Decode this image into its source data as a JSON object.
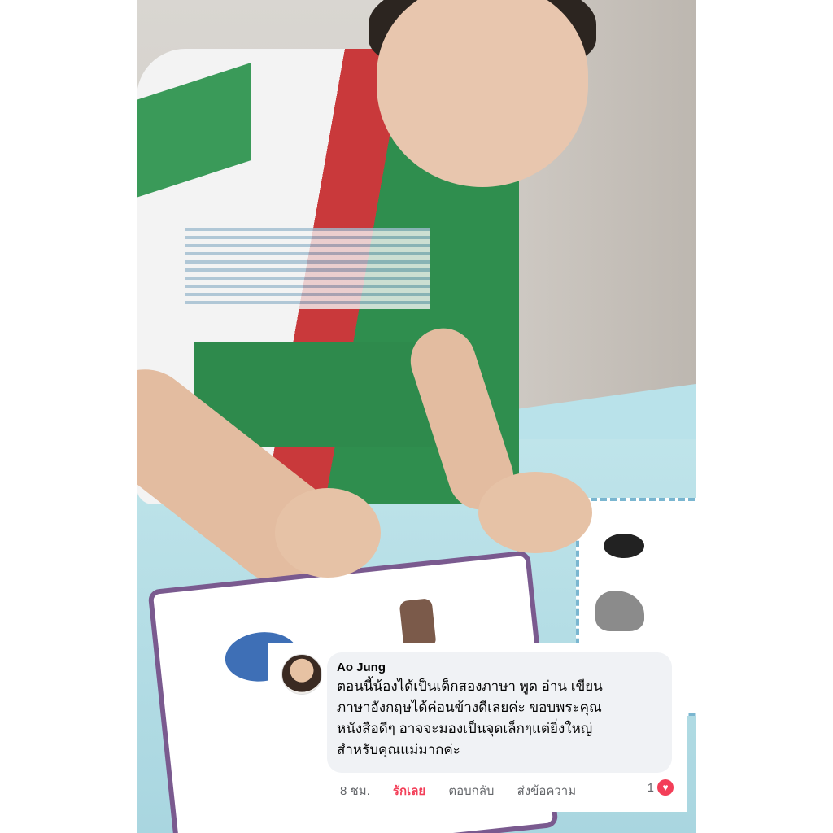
{
  "comment": {
    "author": "Ao Jung",
    "text": "ตอนนี้น้องได้เป็นเด็กสองภาษา พูด อ่าน เขียน\nภาษาอังกฤษได้ค่อนข้างดีเลยค่ะ ขอบพระคุณ\nหนังสือดีๆ อาจจะมองเป็นจุดเล็กๆแต่ยิ่งใหญ่\nสำหรับคุณแม่มากค่ะ",
    "time": "8 ชม.",
    "love_label": "รักเลย",
    "reply_label": "ตอบกลับ",
    "message_label": "ส่งข้อความ",
    "reaction_count": "1"
  },
  "colors": {
    "love": "#f33e58",
    "bubble": "#f0f2f5"
  },
  "icons": {
    "reaction": "heart-icon",
    "avatar": "profile-photo"
  }
}
